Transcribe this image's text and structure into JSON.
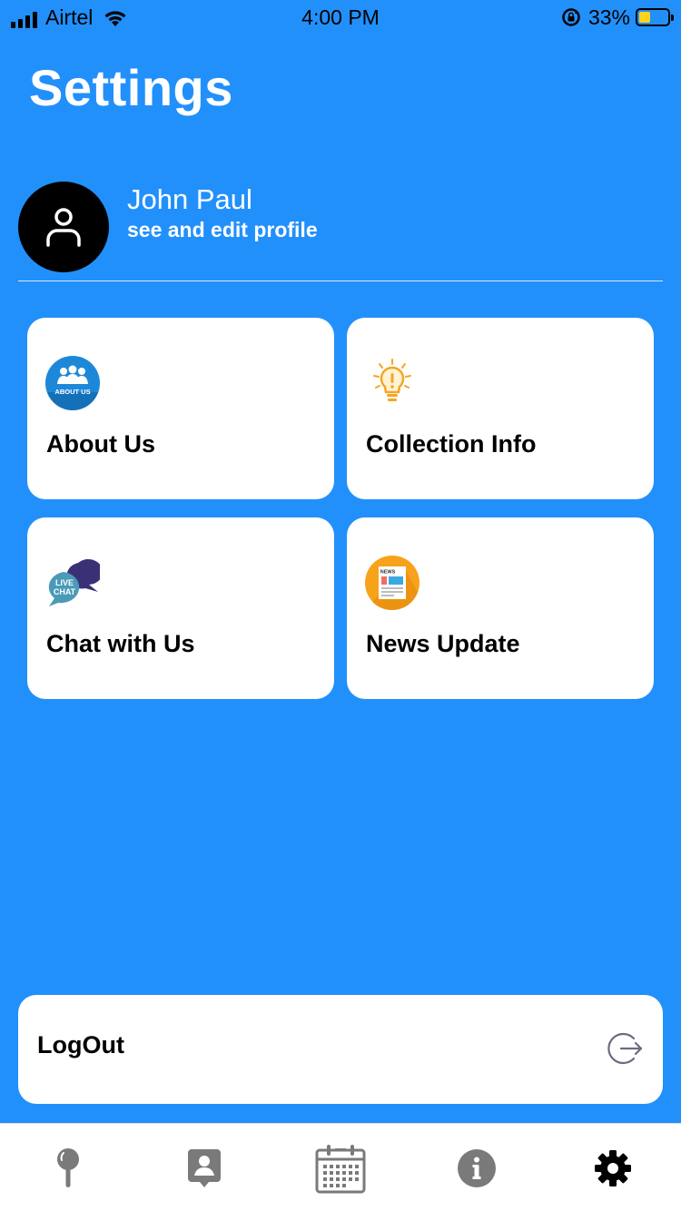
{
  "status_bar": {
    "carrier": "Airtel",
    "time": "4:00 PM",
    "battery_percent": "33%"
  },
  "page": {
    "title": "Settings"
  },
  "profile": {
    "name": "John Paul",
    "subtitle": "see and edit profile"
  },
  "cards": {
    "about": {
      "label": "About Us",
      "icon": "about-us-badge-icon",
      "badge_text": "ABOUT US"
    },
    "collection": {
      "label": "Collection Info",
      "icon": "lightbulb-icon"
    },
    "chat": {
      "label": "Chat with Us",
      "icon": "live-chat-icon",
      "badge_text_1": "LIVE",
      "badge_text_2": "CHAT"
    },
    "news": {
      "label": "News Update",
      "icon": "newspaper-icon",
      "badge_text": "NEWS"
    }
  },
  "logout": {
    "label": "LogOut",
    "icon": "logout-icon"
  },
  "tab_bar": {
    "items": [
      {
        "name": "location-pin-icon"
      },
      {
        "name": "contact-card-icon"
      },
      {
        "name": "calendar-icon"
      },
      {
        "name": "info-icon"
      },
      {
        "name": "gear-icon",
        "active": true
      }
    ]
  },
  "colors": {
    "background": "#2290fb",
    "card": "#ffffff",
    "tab_icon": "#7a7a7a",
    "tab_active": "#000000"
  }
}
